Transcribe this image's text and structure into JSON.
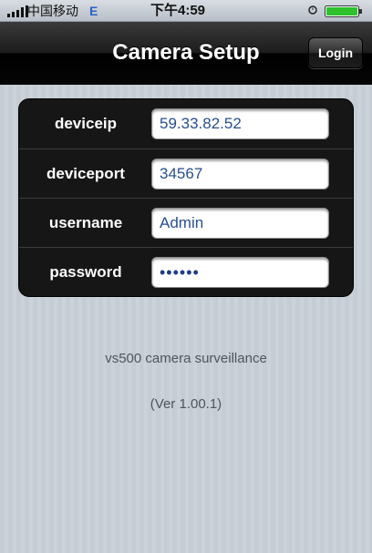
{
  "status_bar": {
    "carrier": "中国移动",
    "network_type": "E",
    "time": "下午4:59",
    "signal_icon": "signal-bars-icon",
    "alarm_icon": "alarm-clock-icon",
    "battery_icon": "battery-icon",
    "battery_color": "#2ec22e"
  },
  "nav_bar": {
    "title": "Camera Setup",
    "login_label": "Login"
  },
  "form": {
    "fields": [
      {
        "label": "deviceip",
        "value": "59.33.82.52"
      },
      {
        "label": "deviceport",
        "value": "34567"
      },
      {
        "label": "username",
        "value": "Admin"
      },
      {
        "label": "password",
        "value": "••••••"
      }
    ]
  },
  "footer": {
    "app_name": "vs500 camera surveillance",
    "version": "(Ver 1.00.1)"
  },
  "colors": {
    "input_text": "#274f8f",
    "panel_background": "#161616",
    "page_background": "#c5ccd4",
    "footer_text": "#4f555c"
  }
}
